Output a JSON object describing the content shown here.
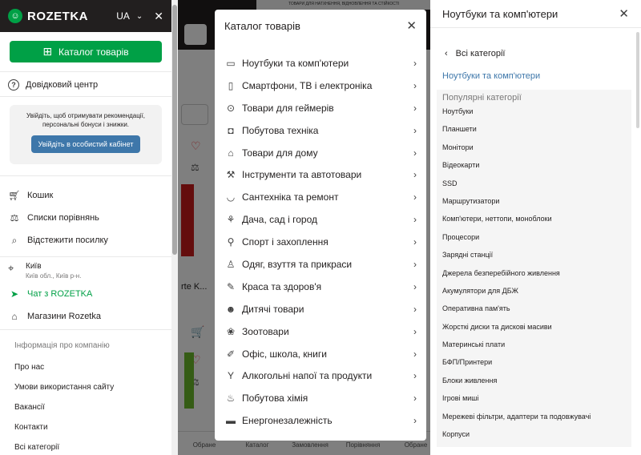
{
  "background": {
    "banner_text": "ТОВАРИ ДЛЯ НАТХНЕННЯ, ВІДНОВЛЕННЯ ТА СТІЙКОСТІ",
    "product_title": "rte K...",
    "bottom_bar": [
      "Обране",
      "Каталог",
      "Замовлення",
      "Порівняння",
      "Обране"
    ]
  },
  "sidebar": {
    "logo": "ROZETKA",
    "language": "UA",
    "catalog_button": "Каталог товарів",
    "help_center": "Довідковий центр",
    "login_prompt": "Увійдіть, щоб отримувати рекомендації, персональні бонуси і знижки.",
    "login_button": "Увійдіть в особистий кабінет",
    "menu": [
      {
        "label": "Кошик",
        "icon": "cart-icon"
      },
      {
        "label": "Списки порівнянь",
        "icon": "scales-icon"
      },
      {
        "label": "Відстежити посилку",
        "icon": "package-search-icon"
      }
    ],
    "location": {
      "city": "Київ",
      "region": "Київ обл., Київ р-н."
    },
    "chat": "Чат з ROZETKA",
    "stores": "Магазини Rozetka",
    "info_title": "Інформація про компанію",
    "info_links": [
      "Про нас",
      "Умови використання сайту",
      "Вакансії",
      "Контакти",
      "Всі категорії"
    ]
  },
  "catalog": {
    "title": "Каталог товарів",
    "items": [
      {
        "label": "Ноутбуки та комп'ютери",
        "icon": "laptop-icon"
      },
      {
        "label": "Смартфони, ТВ і електроніка",
        "icon": "phone-icon"
      },
      {
        "label": "Товари для геймерів",
        "icon": "gamepad-icon"
      },
      {
        "label": "Побутова техніка",
        "icon": "washing-machine-icon"
      },
      {
        "label": "Товари для дому",
        "icon": "armchair-icon"
      },
      {
        "label": "Інструменти та автотовари",
        "icon": "tools-icon"
      },
      {
        "label": "Сантехніка та ремонт",
        "icon": "bathtub-icon"
      },
      {
        "label": "Дача, сад і город",
        "icon": "garden-icon"
      },
      {
        "label": "Спорт і захоплення",
        "icon": "sport-icon"
      },
      {
        "label": "Одяг, взуття та прикраси",
        "icon": "tshirt-icon"
      },
      {
        "label": "Краса та здоров'я",
        "icon": "beauty-icon"
      },
      {
        "label": "Дитячі товари",
        "icon": "teddy-bear-icon"
      },
      {
        "label": "Зоотовари",
        "icon": "paw-icon"
      },
      {
        "label": "Офіс, школа, книги",
        "icon": "pencil-icon"
      },
      {
        "label": "Алкогольні напої та продукти",
        "icon": "wine-glass-icon"
      },
      {
        "label": "Побутова хімія",
        "icon": "detergent-icon"
      },
      {
        "label": "Енергонезалежність",
        "icon": "battery-icon"
      }
    ]
  },
  "subcatalog": {
    "title": "Ноутбуки та комп'ютери",
    "back_label": "Всі категорії",
    "current_category": "Ноутбуки та комп'ютери",
    "popular_title": "Популярні категорії",
    "items": [
      "Ноутбуки",
      "Планшети",
      "Монітори",
      "Відеокарти",
      "SSD",
      "Маршрутизатори",
      "Комп'ютери, неттопи, моноблоки",
      "Процесори",
      "Зарядні станції",
      "Джерела безперебійного живлення",
      "Акумулятори для ДБЖ",
      "Оперативна пам'ять",
      "Жорсткі диски та дискові масиви",
      "Материнські плати",
      "БФП/Принтери",
      "Блоки живлення",
      "Ігрові миші",
      "Мережеві фільтри, адаптери та подовжувачі",
      "Корпуси"
    ]
  }
}
